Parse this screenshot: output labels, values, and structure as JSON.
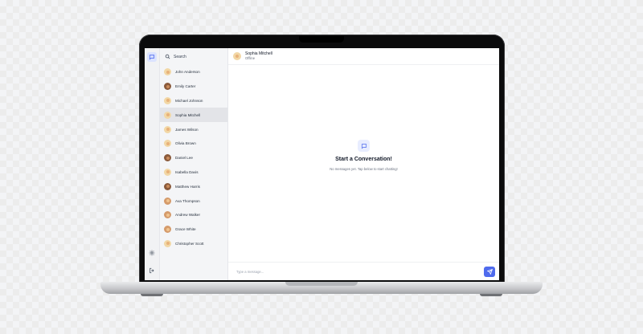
{
  "rail": {
    "icons": [
      "chat-bubble-icon",
      "gear-icon",
      "logout-icon"
    ]
  },
  "sidebar": {
    "search_label": "Search",
    "contacts": [
      {
        "name": "John Anderson",
        "avatar": "light"
      },
      {
        "name": "Emily Carter",
        "avatar": "dark"
      },
      {
        "name": "Michael Johnson",
        "avatar": "light"
      },
      {
        "name": "Sophia Mitchell",
        "avatar": "light",
        "selected": true
      },
      {
        "name": "James Wilson",
        "avatar": "light"
      },
      {
        "name": "Olivia Brown",
        "avatar": "light"
      },
      {
        "name": "Daniel Lee",
        "avatar": "dark"
      },
      {
        "name": "Isabella Davis",
        "avatar": "light"
      },
      {
        "name": "Matthew Harris",
        "avatar": "dark"
      },
      {
        "name": "Ava Thompson",
        "avatar": "mid"
      },
      {
        "name": "Andrew Walker",
        "avatar": "mid"
      },
      {
        "name": "Grace White",
        "avatar": "mid"
      },
      {
        "name": "Christopher Scott",
        "avatar": "light"
      }
    ]
  },
  "chat": {
    "contact_name": "Sophia Mitchell",
    "status": "Offline",
    "empty_title": "Start a Conversation!",
    "empty_subtitle": "No messages yet. Tap below to start chatting!",
    "composer_placeholder": "Type a message...",
    "accent_color": "#4f6bed"
  }
}
